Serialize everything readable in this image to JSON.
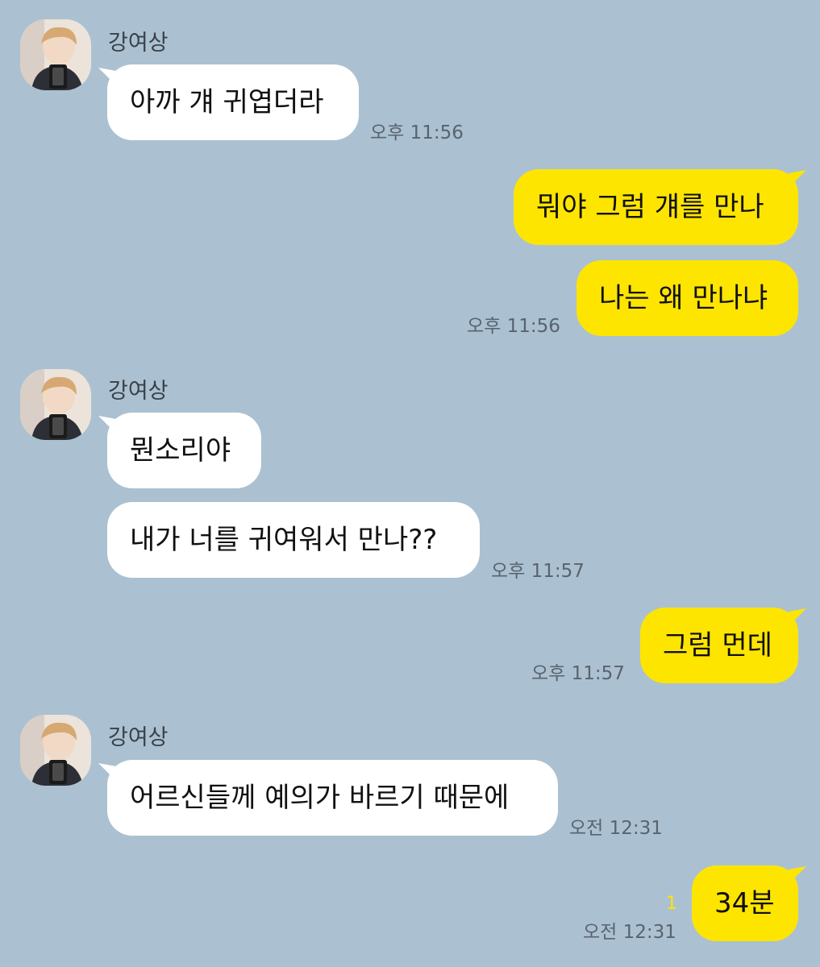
{
  "groups": [
    {
      "sender": "강여상",
      "messages": [
        "아까 걔 귀엽더라"
      ],
      "time": "오후 11:56"
    },
    {
      "messages": [
        "뭐야 그럼 걔를 만나",
        "나는 왜 만나냐"
      ],
      "time": "오후 11:56"
    },
    {
      "sender": "강여상",
      "messages": [
        "뭔소리야",
        "내가 너를 귀여워서 만나??"
      ],
      "time": "오후 11:57"
    },
    {
      "messages": [
        "그럼 먼데"
      ],
      "time": "오후 11:57"
    },
    {
      "sender": "강여상",
      "messages": [
        "어르신들께 예의가 바르기 때문에"
      ],
      "time": "오전 12:31"
    },
    {
      "messages": [
        "34분"
      ],
      "time": "오전 12:31",
      "unread": "1"
    }
  ],
  "colors": {
    "background": "#abc1d1",
    "incoming_bubble": "#ffffff",
    "outgoing_bubble": "#fee500",
    "unread_count": "#fee500",
    "timestamp": "#59636e"
  }
}
